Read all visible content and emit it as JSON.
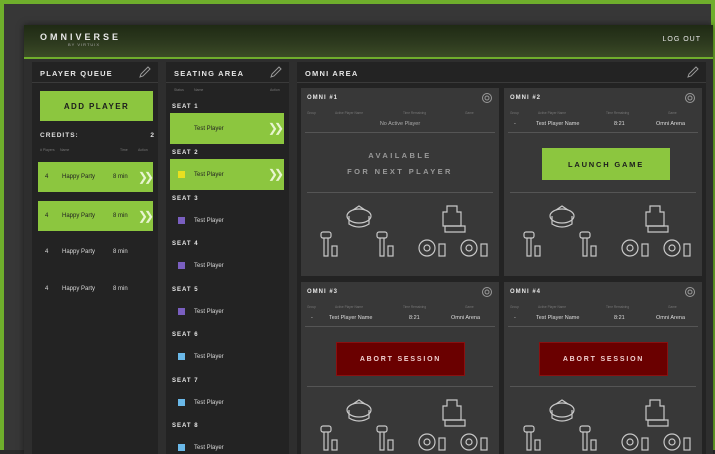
{
  "app": {
    "logo": "OMNIVERSE",
    "logo_sub": "BY VIRTUIX",
    "logout": "LOG OUT",
    "accent": "#8cc63f",
    "abort_color": "#6a0000"
  },
  "queue": {
    "title": "PLAYER QUEUE",
    "add_label": "ADD PLAYER",
    "credits_label": "CREDITS:",
    "credits_value": "2",
    "columns": [
      "# Players",
      "Name",
      "Time",
      "Action"
    ],
    "items": [
      {
        "num": "4",
        "name": "Happy Party",
        "time": "8 min",
        "active": true
      },
      {
        "num": "4",
        "name": "Happy Party",
        "time": "8 min",
        "active": true
      },
      {
        "num": "4",
        "name": "Happy Party",
        "time": "8 min",
        "active": false
      },
      {
        "num": "4",
        "name": "Happy Party",
        "time": "8 min",
        "active": false
      }
    ]
  },
  "seating": {
    "title": "SEATING AREA",
    "columns": [
      "Status",
      "Name",
      "Action"
    ],
    "seats": [
      {
        "label": "SEAT 1",
        "name": "Test Player",
        "color": "#8cc63f",
        "active": true
      },
      {
        "label": "SEAT 2",
        "name": "Test Player",
        "color": "#e8e020",
        "active": true
      },
      {
        "label": "SEAT 3",
        "name": "Test Player",
        "color": "#7a5fc0",
        "active": false
      },
      {
        "label": "SEAT 4",
        "name": "Test Player",
        "color": "#7a5fc0",
        "active": false
      },
      {
        "label": "SEAT 5",
        "name": "Test Player",
        "color": "#7a5fc0",
        "active": false
      },
      {
        "label": "SEAT 6",
        "name": "Test Player",
        "color": "#6ab8e8",
        "active": false
      },
      {
        "label": "SEAT 7",
        "name": "Test Player",
        "color": "#6ab8e8",
        "active": false
      },
      {
        "label": "SEAT 8",
        "name": "Test Player",
        "color": "#6ab8e8",
        "active": false
      }
    ]
  },
  "omni": {
    "title": "OMNI AREA",
    "columns": [
      "Group",
      "Active Player Name",
      "Time Remaining",
      "Game"
    ],
    "cards": [
      {
        "title": "OMNI #1",
        "empty_text": "No Active Player",
        "available_1": "AVAILABLE",
        "available_2": "FOR NEXT PLAYER"
      },
      {
        "title": "OMNI #2",
        "group": "-",
        "player": "Test Player Name",
        "time": "8:21",
        "game": "Omni Arena",
        "action": "LAUNCH GAME"
      },
      {
        "title": "OMNI #3",
        "group": "-",
        "player": "Test Player Name",
        "time": "8:21",
        "game": "Omni Arena",
        "action": "ABORT SESSION"
      },
      {
        "title": "OMNI #4",
        "group": "-",
        "player": "Test Player Name",
        "time": "8:21",
        "game": "Omni Arena",
        "action": "ABORT SESSION"
      }
    ]
  }
}
